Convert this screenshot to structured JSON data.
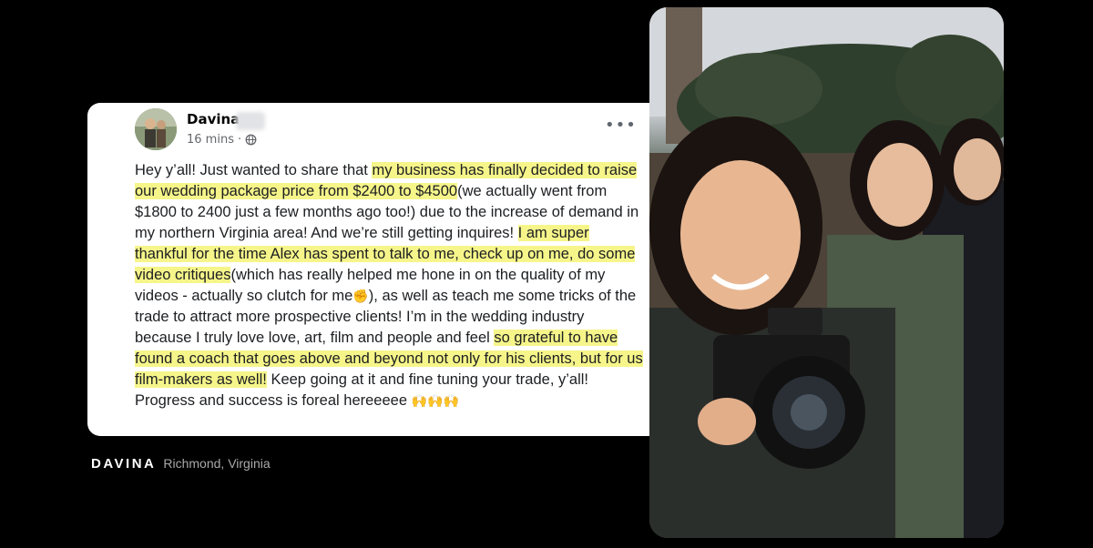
{
  "post": {
    "author_name": "Davina",
    "timestamp": "16 mins",
    "separator": "·",
    "more_label": "•••",
    "text": {
      "s1": "Hey y’all! Just wanted to share that ",
      "h1": "my business has finally decided to raise our wedding package price from $2400 to $4500",
      "s2": "(we actually went from $1800 to 2400 just a few months ago too!) due to the increase of demand in my northern Virginia area! And we’re still getting inquires! ",
      "h2": "I am super thankful for the time Alex has spent to talk to me, check up on me, do some video critiques",
      "s3": "(which has really helped me hone in on the quality of my videos - actually so clutch for me",
      "emoji_fist": "✊",
      "s4": "), as well as teach me some tricks of the trade to attract more prospective clients! I’m in the wedding industry because I truly love love, art, film and people and feel ",
      "h3": "so grateful to have found a coach that goes above and beyond not only for his clients, but for us film-makers as well!",
      "s5": " Keep going at it and fine tuning your trade, y’all! Progress and success is foreal hereeeee ",
      "emoji_hands": "🙌🙌🙌"
    }
  },
  "caption": {
    "name": "DAVINA",
    "location": "Richmond, Virginia"
  },
  "icons": {
    "privacy": "globe-icon",
    "more": "more-options-icon"
  },
  "colors": {
    "highlight": "#f6f58a",
    "background": "#000000",
    "card": "#ffffff"
  }
}
